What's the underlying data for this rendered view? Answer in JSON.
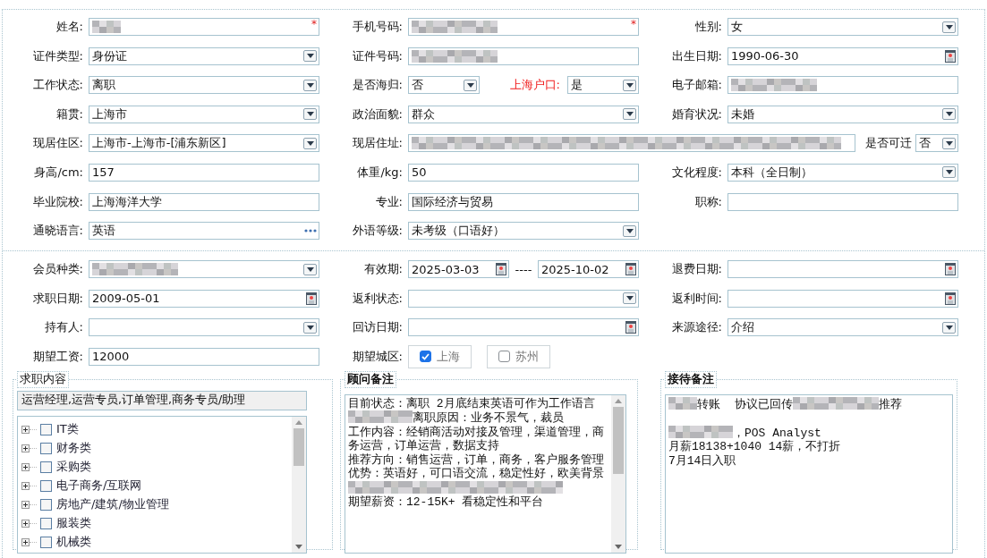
{
  "sections": [
    {
      "rows": [
        [
          {
            "label": "姓名:",
            "kind": "text",
            "redacted": true,
            "marker": "*"
          },
          {
            "label": "手机号码:",
            "kind": "text",
            "redacted": true,
            "marker": "*"
          },
          {
            "label": "性别:",
            "kind": "select",
            "value": "女"
          }
        ],
        [
          {
            "label": "证件类型:",
            "kind": "select",
            "value": "身份证"
          },
          {
            "label": "证件号码:",
            "kind": "text",
            "redacted": true
          },
          {
            "label": "出生日期:",
            "kind": "date",
            "value": "1990-06-30"
          }
        ],
        [
          {
            "label": "工作状态:",
            "kind": "select",
            "value": "离职"
          },
          {
            "label": "是否海归:",
            "kind": "pair",
            "value": "否",
            "second_label": "上海户口:",
            "second_label_alert": true,
            "second_value": "是"
          },
          {
            "label": "电子邮箱:",
            "kind": "text",
            "redacted": true
          }
        ],
        [
          {
            "label": "籍贯:",
            "kind": "select",
            "value": "上海市"
          },
          {
            "label": "政治面貌:",
            "kind": "select",
            "value": "群众"
          },
          {
            "label": "婚育状况:",
            "kind": "select",
            "value": "未婚"
          }
        ],
        [
          {
            "label": "现居住区:",
            "kind": "select",
            "value": "上海市-上海市-[浦东新区]"
          },
          {
            "label": "现居住址:",
            "kind": "wide",
            "redacted": true,
            "second_label": "是否可迁",
            "second_label_alert": false,
            "second_value": "否"
          }
        ],
        [
          {
            "label": "身高/cm:",
            "kind": "text",
            "value": "157"
          },
          {
            "label": "体重/kg:",
            "kind": "text",
            "value": "50"
          },
          {
            "label": "文化程度:",
            "kind": "select",
            "value": "本科（全日制）"
          }
        ],
        [
          {
            "label": "毕业院校:",
            "kind": "text",
            "value": "上海海洋大学"
          },
          {
            "label": "专业:",
            "kind": "text",
            "value": "国际经济与贸易"
          },
          {
            "label": "职称:",
            "kind": "text"
          }
        ],
        [
          {
            "label": "通晓语言:",
            "kind": "lookup",
            "value": "英语"
          },
          {
            "label": "外语等级:",
            "kind": "select",
            "value": "未考级（口语好）"
          }
        ]
      ]
    },
    {
      "rows": [
        [
          {
            "label": "会员种类:",
            "kind": "select",
            "redacted": true
          },
          {
            "label": "有效期:",
            "kind": "range",
            "value": "2025-03-03",
            "separator": "----",
            "second_value": "2025-10-02"
          },
          {
            "label": "退费日期:",
            "kind": "date"
          }
        ],
        [
          {
            "label": "求职日期:",
            "kind": "date",
            "value": "2009-05-01"
          },
          {
            "label": "返利状态:",
            "kind": "select"
          },
          {
            "label": "返利时间:",
            "kind": "date"
          }
        ],
        [
          {
            "label": "持有人:",
            "kind": "select"
          },
          {
            "label": "回访日期:",
            "kind": "date"
          },
          {
            "label": "来源途径:",
            "kind": "select",
            "value": "介绍"
          }
        ],
        [
          {
            "label": "期望工资:",
            "kind": "text",
            "value": "12000"
          },
          {
            "label": "期望城区:",
            "kind": "checks",
            "options": [
              {
                "label": "上海",
                "checked": true
              },
              {
                "label": "苏州",
                "checked": false
              }
            ]
          }
        ]
      ]
    }
  ],
  "panels": [
    {
      "title": "求职内容",
      "emphasis": false,
      "kind": "tree",
      "scrollable": true,
      "summary": "运营经理,运营专员,订单管理,商务专员/助理",
      "items": [
        {
          "label": "IT类",
          "checked": false,
          "expanded": false
        },
        {
          "label": "财务类",
          "checked": false,
          "expanded": false
        },
        {
          "label": "采购类",
          "checked": false,
          "expanded": false
        },
        {
          "label": "电子商务/互联网",
          "checked": false,
          "expanded": false
        },
        {
          "label": "房地产/建筑/物业管理",
          "checked": false,
          "expanded": false
        },
        {
          "label": "服装类",
          "checked": false,
          "expanded": false
        },
        {
          "label": "机械类",
          "checked": false,
          "expanded": false
        }
      ]
    },
    {
      "title": "顾问备注",
      "emphasis": true,
      "kind": "notes",
      "scrollable": true,
      "lines": [
        {
          "parts": [
            {
              "text": "目前状态：离职 2月底结束英语可作为工作语言"
            }
          ]
        },
        {
          "parts": [
            {
              "redacted": true
            },
            {
              "text": "离职原因：业务不景气，裁员"
            }
          ]
        },
        {
          "parts": [
            {
              "text": "工作内容：经销商活动对接及管理，渠道管理，商务运营，订单运营，数据支持"
            }
          ]
        },
        {
          "parts": [
            {
              "text": "推荐方向：销售运营，订单，商务，客户服务管理"
            }
          ]
        },
        {
          "parts": [
            {
              "text": "优势：英语好，可口语交流，稳定性好，欧美背景"
            }
          ]
        },
        {
          "parts": [
            {
              "redacted": true
            }
          ]
        },
        {
          "parts": [
            {
              "text": "期望薪资：12-15K+ 看稳定性和平台"
            }
          ]
        }
      ]
    },
    {
      "title": "接待备注",
      "emphasis": true,
      "kind": "notes",
      "scrollable": false,
      "lines": [
        {
          "parts": [
            {
              "redacted": true
            },
            {
              "text": "转账  协议已回传"
            },
            {
              "redacted": true
            },
            {
              "text": "推荐"
            }
          ]
        },
        {
          "gap_before": true,
          "parts": [
            {
              "redacted": true
            },
            {
              "text": "，POS Analyst"
            }
          ]
        },
        {
          "parts": [
            {
              "text": "月薪18138+1040 14薪，不打折"
            }
          ]
        },
        {
          "parts": [
            {
              "text": "7月14日入职"
            }
          ]
        }
      ]
    }
  ]
}
